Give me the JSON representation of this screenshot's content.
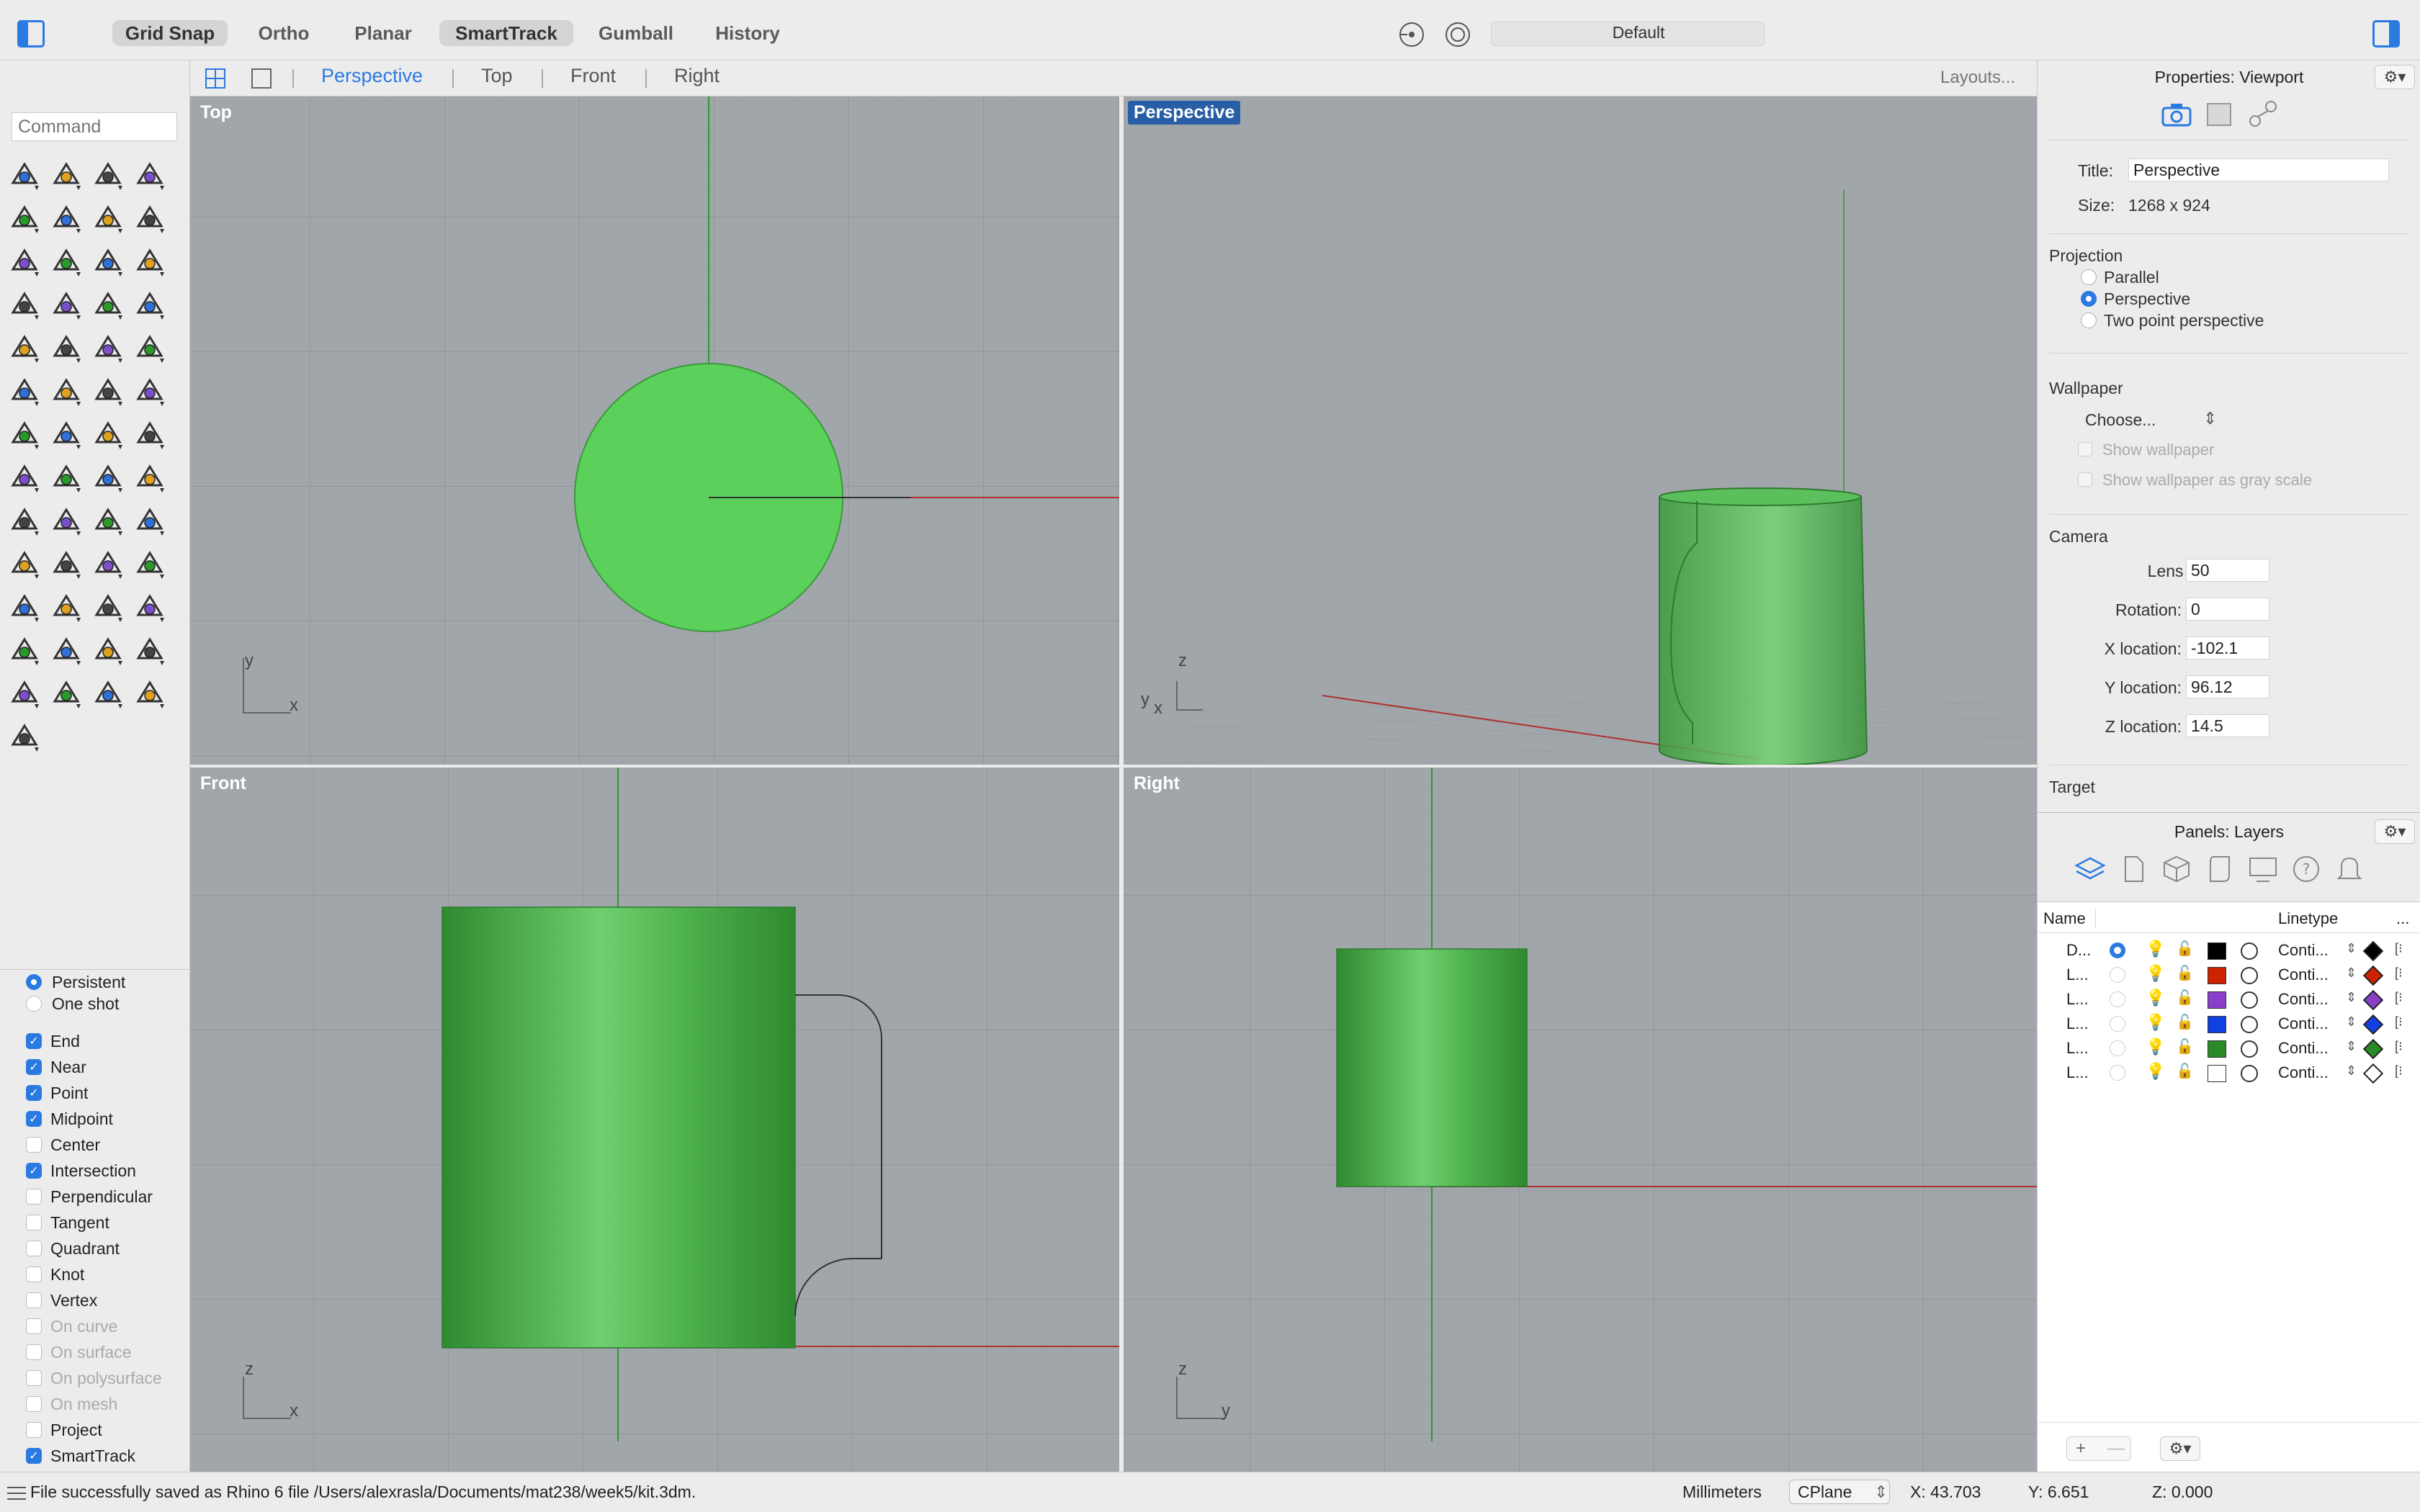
{
  "toolbar": {
    "grid_snap": "Grid Snap",
    "ortho": "Ortho",
    "planar": "Planar",
    "smarttrack": "SmartTrack",
    "gumball": "Gumball",
    "history": "History",
    "current_layer": "Default"
  },
  "viewport_tabs": {
    "perspective": "Perspective",
    "top": "Top",
    "front": "Front",
    "right": "Right",
    "layouts": "Layouts..."
  },
  "command": {
    "placeholder": "Command"
  },
  "viewports": {
    "top": {
      "label": "Top",
      "axis_v": "y",
      "axis_h": "x"
    },
    "perspective": {
      "label": "Perspective",
      "axis_v": "z",
      "axis_h": "y",
      "axis_x": "x"
    },
    "front": {
      "label": "Front",
      "axis_v": "z",
      "axis_h": "x"
    },
    "right": {
      "label": "Right",
      "axis_v": "z",
      "axis_h": "y"
    }
  },
  "osnap": {
    "persistent": "Persistent",
    "one_shot": "One shot",
    "items": [
      {
        "label": "End",
        "checked": true,
        "enabled": true
      },
      {
        "label": "Near",
        "checked": true,
        "enabled": true
      },
      {
        "label": "Point",
        "checked": true,
        "enabled": true
      },
      {
        "label": "Midpoint",
        "checked": true,
        "enabled": true
      },
      {
        "label": "Center",
        "checked": false,
        "enabled": true
      },
      {
        "label": "Intersection",
        "checked": true,
        "enabled": true
      },
      {
        "label": "Perpendicular",
        "checked": false,
        "enabled": true
      },
      {
        "label": "Tangent",
        "checked": false,
        "enabled": true
      },
      {
        "label": "Quadrant",
        "checked": false,
        "enabled": true
      },
      {
        "label": "Knot",
        "checked": false,
        "enabled": true
      },
      {
        "label": "Vertex",
        "checked": false,
        "enabled": true
      },
      {
        "label": "On curve",
        "checked": false,
        "enabled": false
      },
      {
        "label": "On surface",
        "checked": false,
        "enabled": false
      },
      {
        "label": "On polysurface",
        "checked": false,
        "enabled": false
      },
      {
        "label": "On mesh",
        "checked": false,
        "enabled": false
      },
      {
        "label": "Project",
        "checked": false,
        "enabled": true
      },
      {
        "label": "SmartTrack",
        "checked": true,
        "enabled": true
      }
    ]
  },
  "properties": {
    "header": "Properties: Viewport",
    "title_label": "Title:",
    "title_value": "Perspective",
    "size_label": "Size:",
    "size_value": "1268 x 924",
    "projection_header": "Projection",
    "projection_options": [
      "Parallel",
      "Perspective",
      "Two point perspective"
    ],
    "projection_selected": 1,
    "wallpaper_header": "Wallpaper",
    "wallpaper_choose": "Choose...",
    "show_wallpaper": "Show wallpaper",
    "show_gray": "Show wallpaper as gray scale",
    "camera_header": "Camera",
    "lens_label": "Lens length:",
    "lens_value": "50",
    "rotation_label": "Rotation:",
    "rotation_value": "0",
    "xloc_label": "X location:",
    "xloc_value": "-102.1",
    "yloc_label": "Y location:",
    "yloc_value": "96.12",
    "zloc_label": "Z location:",
    "zloc_value": "14.5",
    "target_header": "Target"
  },
  "layers_panel": {
    "header": "Panels: Layers",
    "col_name": "Name",
    "col_linetype": "Linetype",
    "col_more": "...",
    "rows": [
      {
        "name": "D...",
        "current": true,
        "color": "#000000",
        "linetype": "Conti...",
        "material": "#000000"
      },
      {
        "name": "L...",
        "current": false,
        "color": "#cc2200",
        "linetype": "Conti...",
        "material": "#cc2200"
      },
      {
        "name": "L...",
        "current": false,
        "color": "#8a3fc8",
        "linetype": "Conti...",
        "material": "#8a3fc8"
      },
      {
        "name": "L...",
        "current": false,
        "color": "#1040e0",
        "linetype": "Conti...",
        "material": "#1040e0"
      },
      {
        "name": "L...",
        "current": false,
        "color": "#2a8a2a",
        "linetype": "Conti...",
        "material": "#2a8a2a"
      },
      {
        "name": "L...",
        "current": false,
        "color": "#ffffff",
        "linetype": "Conti...",
        "material": "#ffffff"
      }
    ]
  },
  "status": {
    "message": "File successfully saved as Rhino 6 file /Users/alexrasla/Documents/mat238/week5/kit.3dm.",
    "units": "Millimeters",
    "cplane": "CPlane",
    "x": "X: 43.703",
    "y": "Y: 6.651",
    "z": "Z: 0.000"
  },
  "colors": {
    "accent": "#2a7ae2",
    "viewport_bg": "#a1a6ab",
    "object_green": "#55cc55",
    "x_axis": "#b03030",
    "y_axis": "#2a9a2a"
  }
}
